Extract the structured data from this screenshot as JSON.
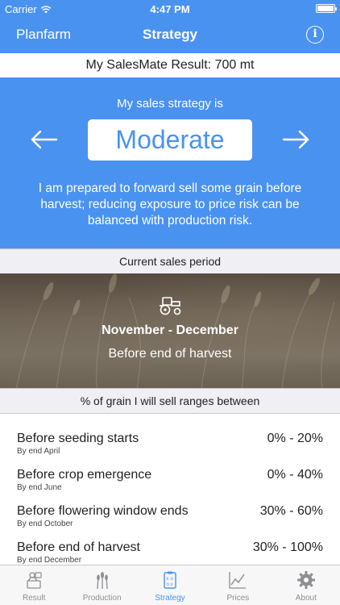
{
  "status_bar": {
    "carrier": "Carrier",
    "time": "4:47 PM",
    "battery_level": 1.0
  },
  "nav": {
    "back_label": "Planfarm",
    "title": "Strategy",
    "info_label": "i"
  },
  "result": {
    "text": "My SalesMate Result: 700 mt"
  },
  "strategy": {
    "heading": "My sales strategy is",
    "level": "Moderate",
    "description": "I am prepared to forward sell some grain before harvest; reducing exposure to price risk can be balanced with production risk."
  },
  "current_period": {
    "header": "Current sales period",
    "months": "November - December",
    "stage": "Before end of harvest"
  },
  "ranges": {
    "header": "% of grain I will sell ranges between",
    "rows": [
      {
        "label": "Before seeding starts",
        "sub": "By end April",
        "value": "0% - 20%"
      },
      {
        "label": "Before crop emergence",
        "sub": "By end June",
        "value": "0% - 40%"
      },
      {
        "label": "Before flowering window ends",
        "sub": "By end October",
        "value": "30% - 60%"
      },
      {
        "label": "Before end of harvest",
        "sub": "By end December",
        "value": "30% - 100%"
      }
    ]
  },
  "tabs": [
    {
      "label": "Result",
      "icon": "result-icon"
    },
    {
      "label": "Production",
      "icon": "wheat-icon"
    },
    {
      "label": "Strategy",
      "icon": "strategy-icon",
      "active": true
    },
    {
      "label": "Prices",
      "icon": "chart-icon"
    },
    {
      "label": "About",
      "icon": "gear-icon"
    }
  ],
  "colors": {
    "accent": "#4a92f0",
    "section_bg": "#efeff4",
    "tab_inactive": "#8e8e93"
  }
}
